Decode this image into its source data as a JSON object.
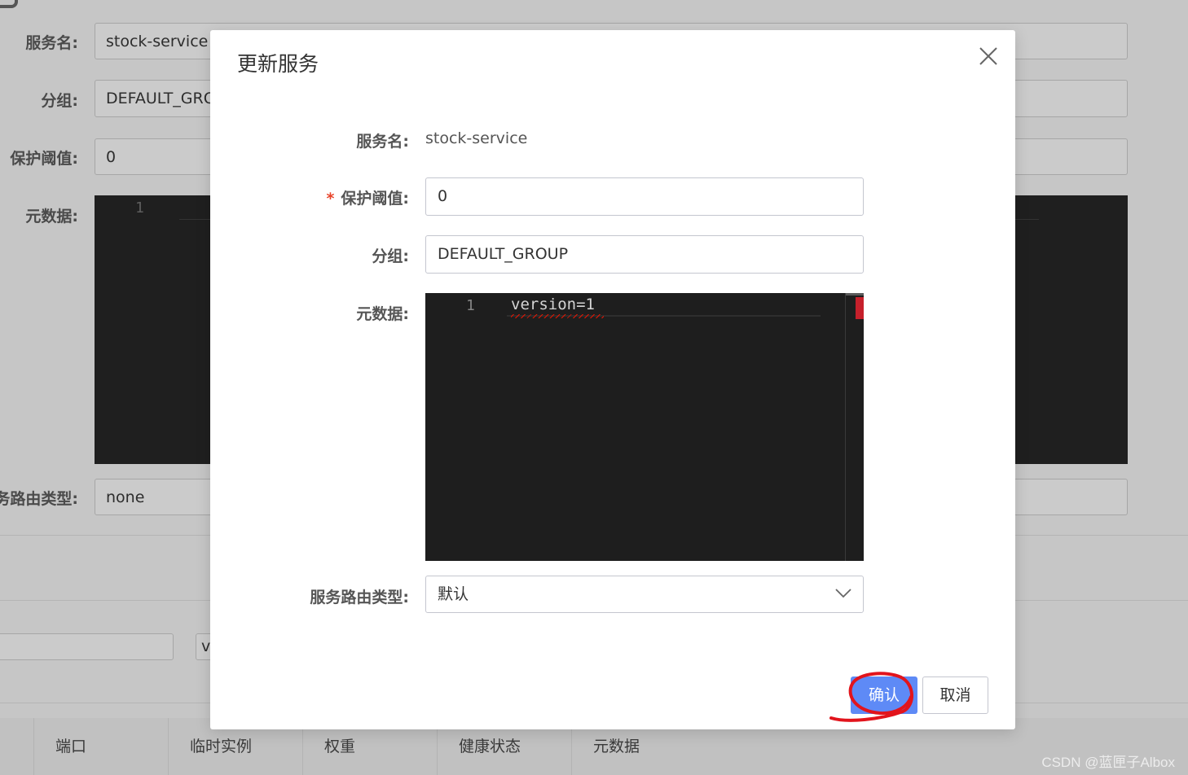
{
  "background": {
    "labels": {
      "service_name": "服务名:",
      "group": "分组:",
      "protect_threshold": "保护阈值:",
      "metadata": "元数据:",
      "route_type": "务路由类型:"
    },
    "values": {
      "service_name": "stock-service",
      "group": "DEFAULT_GRO",
      "protect_threshold": "0",
      "route_type": "none",
      "filter_partial": "v"
    },
    "editor_line_number": "1",
    "table_headers": [
      "端口",
      "临时实例",
      "权重",
      "健康状态",
      "元数据"
    ]
  },
  "dialog": {
    "title": "更新服务",
    "fields": {
      "service_name": {
        "label": "服务名:",
        "value": "stock-service"
      },
      "protect_threshold": {
        "required_mark": "*",
        "label": "保护阈值:",
        "value": "0"
      },
      "group": {
        "label": "分组:",
        "value": "DEFAULT_GROUP"
      },
      "metadata": {
        "label": "元数据:",
        "line_number": "1",
        "code": "version=1"
      },
      "route_type": {
        "label": "服务路由类型:",
        "value": "默认"
      }
    },
    "confirm_label": "确认",
    "cancel_label": "取消"
  },
  "icons": {
    "close": "close-icon",
    "chevron": "chevron-down-icon"
  },
  "colors": {
    "primary": "#5e8af6",
    "required": "#e8442a",
    "annotation": "#e2141c",
    "editor_bg": "#1e1e1e"
  },
  "watermark": "CSDN @蓝匣子Albox"
}
